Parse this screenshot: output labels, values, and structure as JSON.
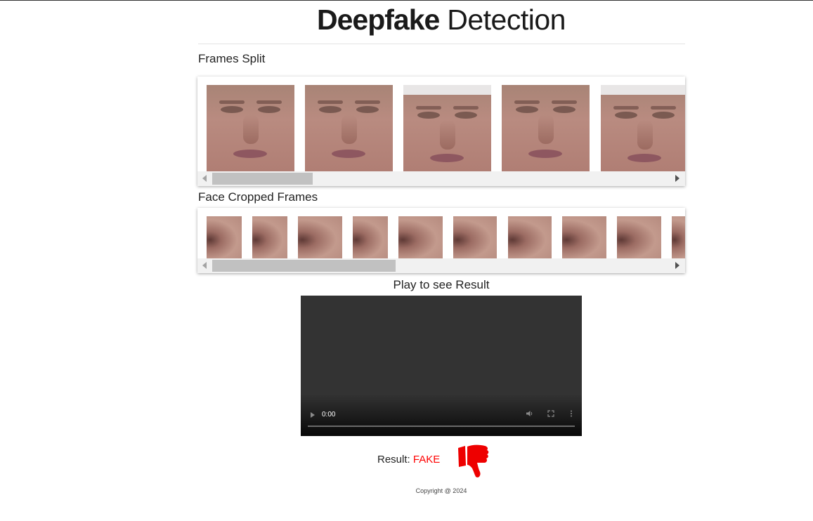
{
  "header": {
    "title_bold": "Deepfake",
    "title_light": "Detection"
  },
  "sections": {
    "frames_split": {
      "title": "Frames Split",
      "frame_count_visible": 5,
      "scroll_fraction": 0.22
    },
    "face_cropped": {
      "title": "Face Cropped Frames",
      "crop_count_visible": 10,
      "scroll_fraction": 0.4
    }
  },
  "player": {
    "title": "Play to see Result",
    "time": "0:00",
    "play_icon": "play-icon",
    "volume_icon": "volume-icon",
    "fullscreen_icon": "fullscreen-icon",
    "menu_icon": "more-vertical-icon"
  },
  "result": {
    "label": "Result:",
    "value": "FAKE",
    "value_color": "#ff0000",
    "icon": "thumbs-down-icon"
  },
  "footer": {
    "copyright": "Copyright @ 2024"
  }
}
